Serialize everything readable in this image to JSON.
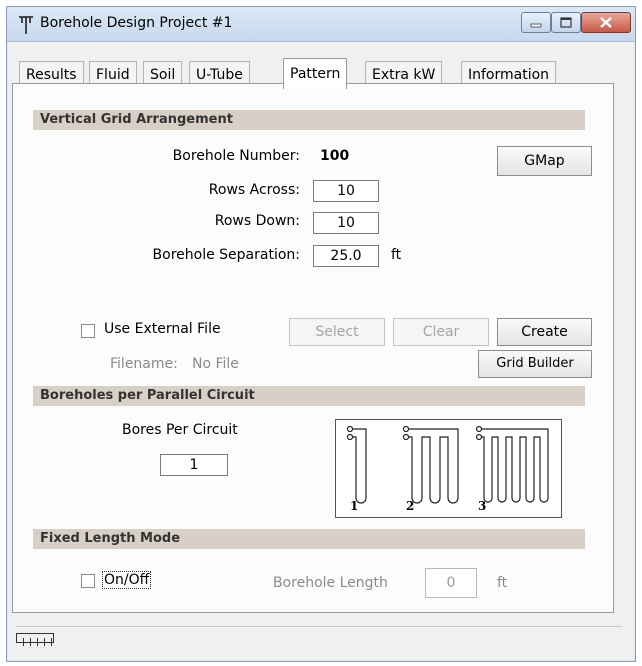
{
  "window": {
    "title": "Borehole Design Project #1"
  },
  "tabs": [
    {
      "label": "Results",
      "active": false
    },
    {
      "label": "Fluid",
      "active": false
    },
    {
      "label": "Soil",
      "active": false
    },
    {
      "label": "U-Tube",
      "active": false
    },
    {
      "label": "Pattern",
      "active": true
    },
    {
      "label": "Extra kW",
      "active": false
    },
    {
      "label": "Information",
      "active": false
    }
  ],
  "vertical_grid": {
    "header": "Vertical Grid Arrangement",
    "borehole_number_label": "Borehole Number:",
    "borehole_number_value": "100",
    "gmap_button": "GMap",
    "rows_across_label": "Rows Across:",
    "rows_across_value": "10",
    "rows_down_label": "Rows Down:",
    "rows_down_value": "10",
    "separation_label": "Borehole Separation:",
    "separation_value": "25.0",
    "separation_unit": "ft"
  },
  "external_file": {
    "checkbox_label": "Use External File",
    "checked": false,
    "select_button": "Select",
    "clear_button": "Clear",
    "create_button": "Create",
    "filename_label": "Filename:",
    "filename_value": "No File",
    "grid_builder_button": "Grid Builder"
  },
  "parallel_circuit": {
    "header": "Boreholes per Parallel Circuit",
    "bores_per_circuit_label": "Bores Per Circuit",
    "bores_per_circuit_value": "1",
    "diagram_labels": [
      "1",
      "2",
      "3"
    ]
  },
  "fixed_length": {
    "header": "Fixed Length Mode",
    "checkbox_label": "On/Off",
    "checked": false,
    "borehole_length_label": "Borehole Length",
    "borehole_length_value": "0",
    "borehole_length_unit": "ft"
  },
  "icons": {
    "app": "borehole-app-icon",
    "minimize": "minimize-icon",
    "maximize": "maximize-icon",
    "close": "close-icon",
    "status": "status-indicator-icon"
  },
  "colors": {
    "section_bar": "#d8cfc6",
    "titlebar": "#c7d9ee",
    "close_button": "#c85845"
  }
}
